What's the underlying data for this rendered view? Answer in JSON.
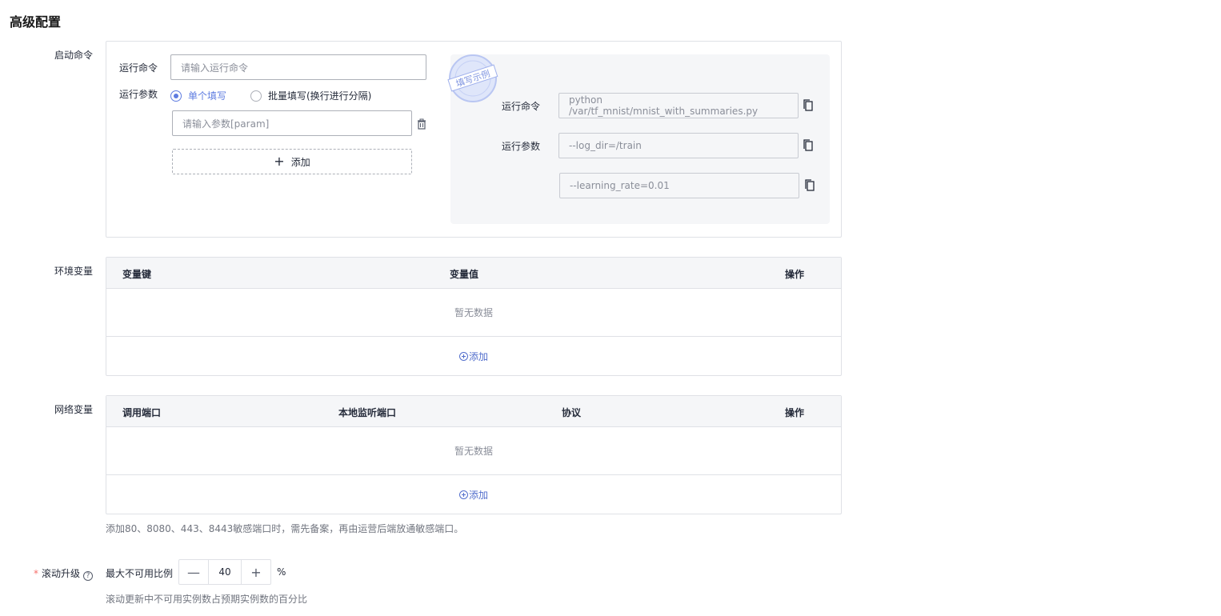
{
  "page": {
    "title": "高级配置"
  },
  "startup": {
    "label": "启动命令",
    "run_command_label": "运行命令",
    "run_command_placeholder": "请输入运行命令",
    "run_params_label": "运行参数",
    "radio_single": "单个填写",
    "radio_batch": "批量填写(换行进行分隔)",
    "param_placeholder": "请输入参数[param]",
    "add_label": "添加",
    "example": {
      "stamp_text": "填写示例",
      "run_command_label": "运行命令",
      "run_command_value": "python /var/tf_mnist/mnist_with_summaries.py",
      "run_params_label": "运行参数",
      "params": [
        "--log_dir=/train",
        "--learning_rate=0.01"
      ]
    }
  },
  "env": {
    "label": "环境变量",
    "columns": [
      "变量键",
      "变量值",
      "操作"
    ],
    "empty_text": "暂无数据",
    "add_label": "添加"
  },
  "network": {
    "label": "网络变量",
    "columns": [
      "调用端口",
      "本地监听端口",
      "协议",
      "操作"
    ],
    "empty_text": "暂无数据",
    "add_label": "添加",
    "hint": "添加80、8080、443、8443敏感端口时，需先备案，再由运营后端放通敏感端口。"
  },
  "rolling": {
    "required_mark": "*",
    "label": "滚动升级",
    "help_icon": "?",
    "max_unavailable_label": "最大不可用比例",
    "decrement": "—",
    "value": "40",
    "increment": "+",
    "unit": "%",
    "hint": "滚动更新中不可用实例数占预期实例数的百分比"
  },
  "colors": {
    "primary": "#5e7ce0",
    "link": "#526ecc",
    "border": "#dfe1e6",
    "required": "#f66f6a"
  }
}
